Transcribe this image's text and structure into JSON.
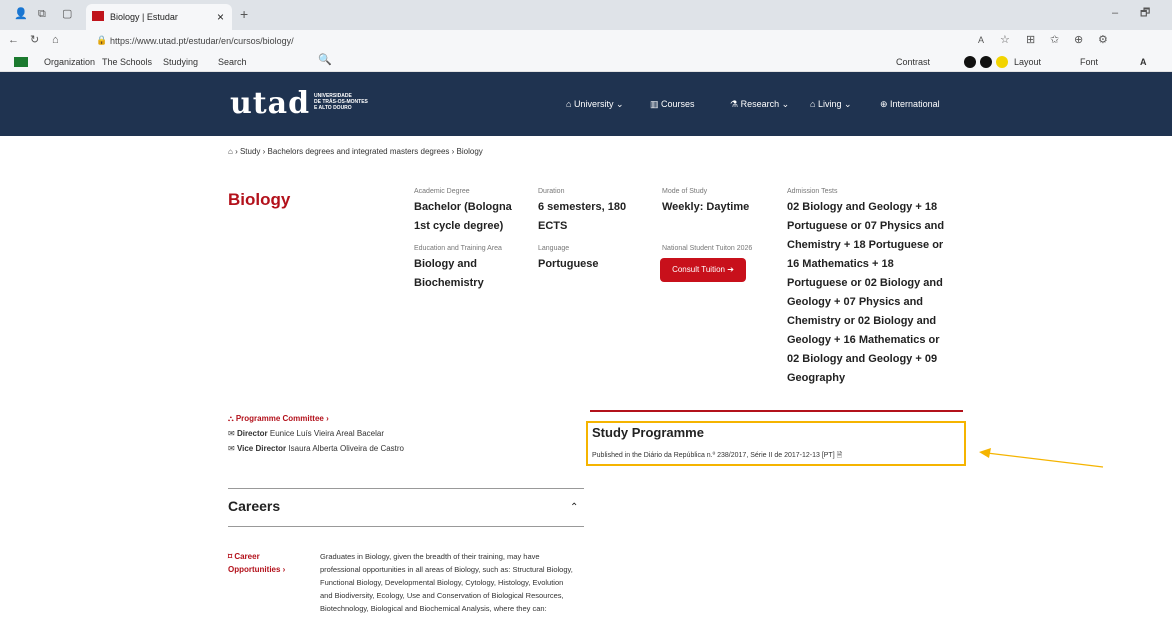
{
  "browser": {
    "tab_title": "Biology | Estudar",
    "new_tab": "+",
    "close_tab": "×",
    "url": "https://www.utad.pt/estudar/en/cursos/biology/",
    "favorites": [
      "Organization",
      "The Schools",
      "Studying",
      "Search"
    ],
    "accessibility": {
      "contrast": "Contrast",
      "layout": "Layout",
      "font": "Font",
      "font_a": "A"
    }
  },
  "site": {
    "logo_text": "utad",
    "logo_sub": [
      "UNIVERSIDADE",
      "DE TRÁS-OS-MONTES",
      "E ALTO DOURO"
    ],
    "nav": [
      "University",
      "Courses",
      "Research",
      "Living",
      "International"
    ],
    "breadcrumb": [
      "Study",
      "Bachelors degrees and integrated masters degrees",
      "Biology"
    ]
  },
  "course": {
    "title": "Biology",
    "academic_degree_label": "Academic Degree",
    "academic_degree": "Bachelor (Bologna 1st cycle degree)",
    "duration_label": "Duration",
    "duration": "6 semesters, 180 ECTS",
    "mode_label": "Mode of Study",
    "mode": "Weekly: Daytime",
    "admission_label": "Admission Tests",
    "admission": "02 Biology and Geology + 18 Portuguese or 07 Physics and Chemistry + 18 Portuguese or 16 Mathematics + 18 Portuguese or 02 Biology and Geology + 07 Physics and Chemistry or 02 Biology and Geology + 16 Mathematics or 02 Biology and Geology + 09 Geography",
    "area_label": "Education and Training Area",
    "area": "Biology and Biochemistry",
    "language_label": "Language",
    "language": "Portuguese",
    "tuition_label": "National Student Tuiton 2026",
    "tuition_button": "Consult Tuition"
  },
  "committee": {
    "title": "Programme Committee",
    "director_label": "Director",
    "director": "Eunice Luís Vieira Areal Bacelar",
    "vice_label": "Vice Director",
    "vice": "Isaura Alberta Oliveira de Castro"
  },
  "study_programme": {
    "title": "Study Programme",
    "published": "Published in the Diário da República n.º 238/2017, Série II de 2017-12-13 [PT]"
  },
  "careers": {
    "title": "Careers",
    "opportunities_label": "Career Opportunities",
    "text": "Graduates in Biology, given the breadth of their training, may have professional opportunities in all areas of Biology, such as: Structural Biology, Functional Biology, Developmental Biology, Cytology, Histology, Evolution and Biodiversity, Ecology, Use and Conservation of Biological Resources, Biotechnology, Biological and Biochemical Analysis, where they can:"
  },
  "colors": {
    "header": "#1f3350",
    "accent": "#b3111b",
    "highlight": "#f5b400"
  }
}
